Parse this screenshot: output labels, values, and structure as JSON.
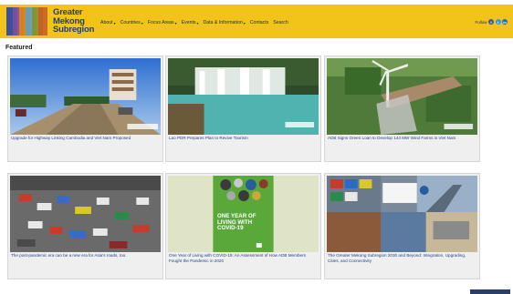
{
  "brand": {
    "line1": "Greater",
    "line2": "Mekong",
    "line3": "Subregion"
  },
  "nav": [
    {
      "label": "About",
      "dropdown": true
    },
    {
      "label": "Countries",
      "dropdown": true
    },
    {
      "label": "Focus Areas",
      "dropdown": true
    },
    {
      "label": "Events",
      "dropdown": true
    },
    {
      "label": "Data & Information",
      "dropdown": true
    },
    {
      "label": "Contacts",
      "dropdown": false
    },
    {
      "label": "Search",
      "dropdown": false
    }
  ],
  "follow": {
    "label": "Follow",
    "icons": [
      "facebook-icon",
      "twitter-icon",
      "linkedin-icon"
    ]
  },
  "featured": {
    "title": "Featured",
    "cards": [
      {
        "caption": "Upgrade for Highway Linking Cambodia and Viet Nam Proposed"
      },
      {
        "caption": "Lao PDR Prepares Plan to Revive Tourism"
      },
      {
        "caption": "ADB Signs Green Loan to Develop 144 MW Wind Farms in Viet Nam"
      },
      {
        "caption": "The post-pandemic era can be a new era for Asia's roads, too."
      },
      {
        "caption": "One Year of Living with COVID-19: An Assessment of How ADB Members Fought the Pandemic in 2020",
        "book_title": "ONE YEAR OF LIVING WITH COVID-19"
      },
      {
        "caption": "The Greater Mekong Subregion 2030 and Beyond: Integration, Upgrading, Cities, and Connectivity"
      }
    ]
  },
  "colors": {
    "header": "#f2c419",
    "brand": "#1f3f7a",
    "link": "#1f3f8a",
    "card_bg": "#efefef"
  }
}
